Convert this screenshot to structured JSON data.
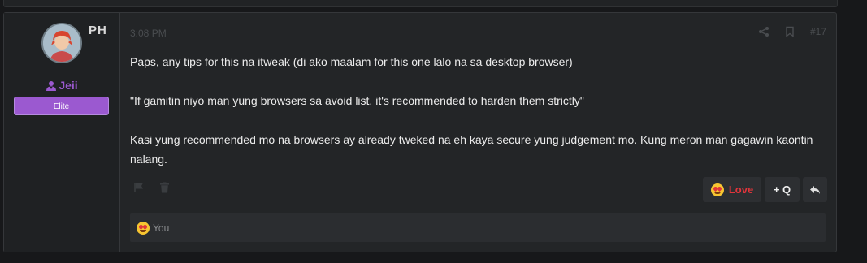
{
  "user": {
    "country": "PH",
    "username": "Jeii",
    "rank": "Elite"
  },
  "post": {
    "timestamp": "3:08 PM",
    "number": "#17",
    "paragraphs": [
      "Paps, any tips for this na itweak (di ako maalam for this one lalo na sa desktop browser)",
      "\"If gamitin niyo man yung browsers sa avoid list, it's recommended to harden them strictly\"",
      "Kasi yung recommended mo na browsers ay already tweked na eh kaya secure yung judgement mo. Kung meron man gagawin kaontin nalang."
    ]
  },
  "actions": {
    "love_label": "Love",
    "quote_label": "+ Q"
  },
  "reactions": {
    "summary_label": "You"
  },
  "colors": {
    "accent_purple": "#9b59d0",
    "love_red": "#e0353b"
  }
}
